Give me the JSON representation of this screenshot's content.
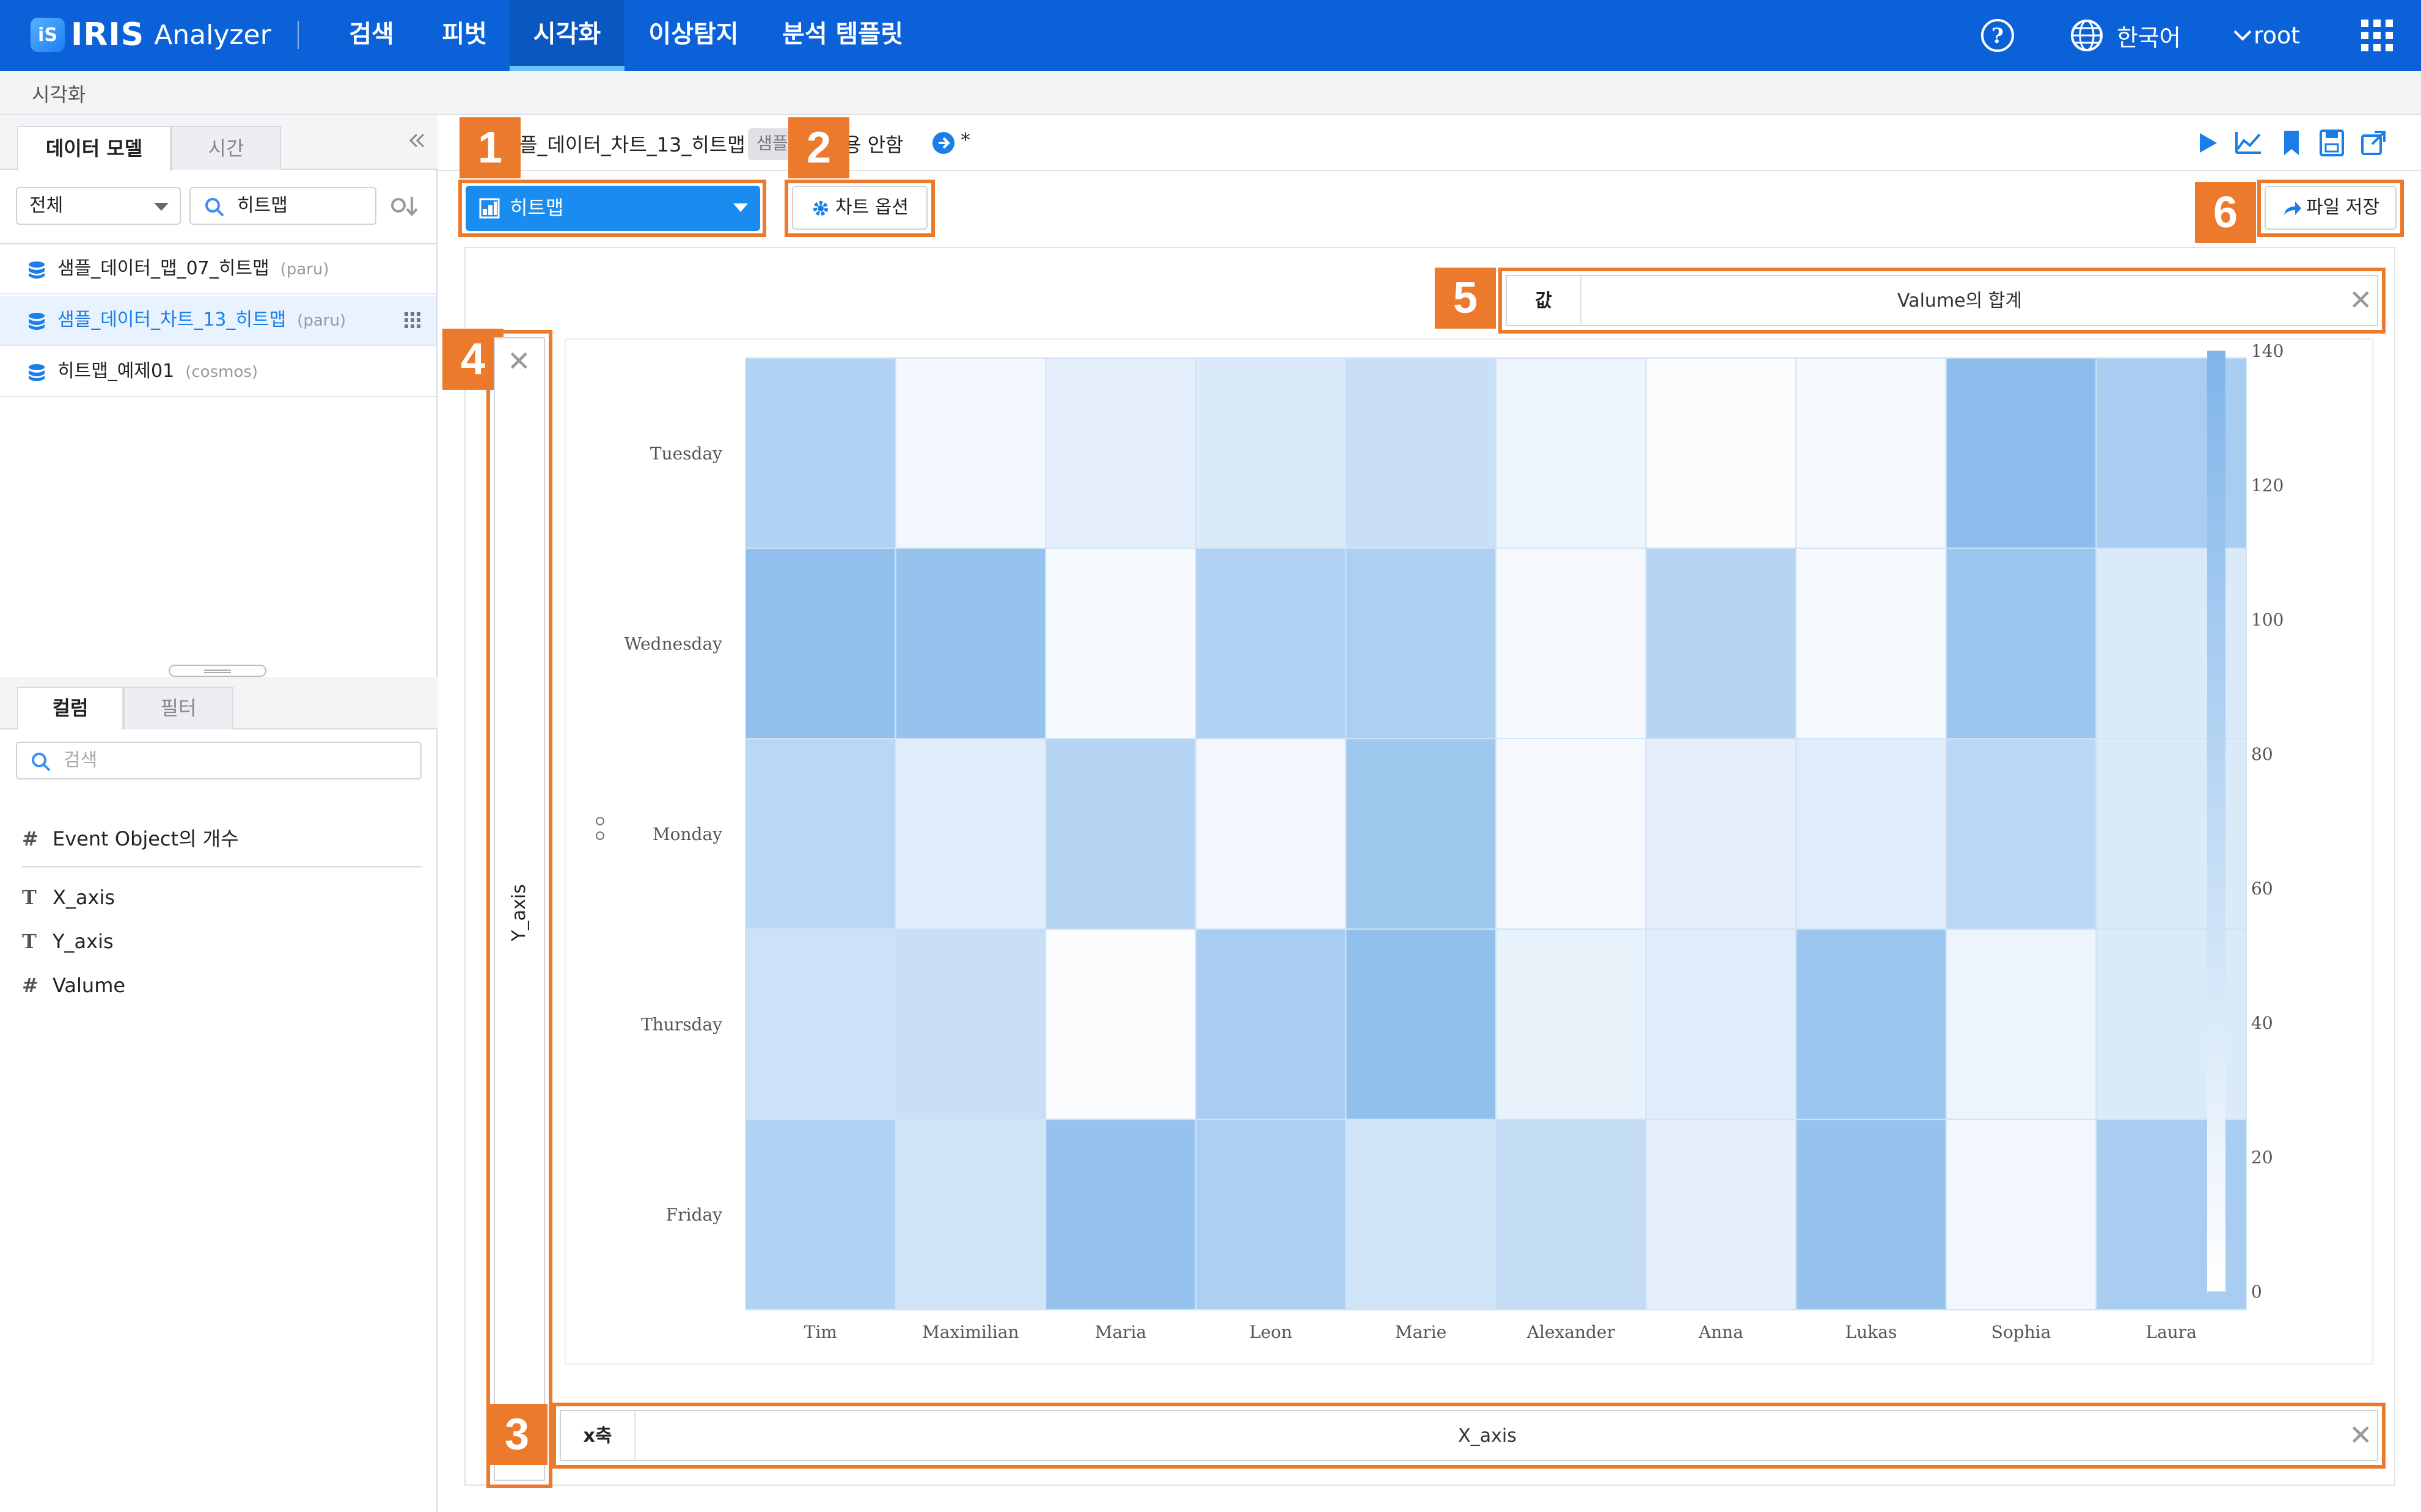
{
  "app": {
    "logo_brand": "IRIS",
    "logo_product": "Analyzer",
    "nav": [
      "검색",
      "피벗",
      "시각화",
      "이상탐지",
      "분석 템플릿"
    ],
    "active_nav": "시각화",
    "language": "한국어",
    "user": "root"
  },
  "breadcrumb": "시각화",
  "left_panel": {
    "tabs": [
      "데이터 모델",
      "시간"
    ],
    "scope_select": "전체",
    "search_value": "히트맵",
    "models": [
      {
        "name": "샘플_데이터_맵_07_히트맵",
        "owner": "(paru)"
      },
      {
        "name": "샘플_데이터_차트_13_히트맵",
        "owner": "(paru)"
      },
      {
        "name": "히트맵_예제01",
        "owner": "(cosmos)"
      }
    ],
    "bottom_tabs": [
      "컬럼",
      "필터"
    ],
    "column_search_placeholder": "검색",
    "columns": [
      {
        "type": "#",
        "name": "Event Object의 개수"
      },
      {
        "type": "T",
        "name": "X_axis"
      },
      {
        "type": "T",
        "name": "Y_axis"
      },
      {
        "type": "#",
        "name": "Valume"
      }
    ]
  },
  "main": {
    "title": "플_데이터_차트_13_히트맵",
    "sample_tag": "샘플",
    "status_text": "용 안함",
    "modified_mark": "*",
    "chart_type": "히트맵",
    "chart_options_label": "차트 옵션",
    "save_file_label": "파일 저장",
    "value_field_label": "값",
    "value_field": "Valume의 합계",
    "y_axis_field": "Y_axis",
    "x_axis_label": "x축",
    "x_axis_field": "X_axis",
    "callouts": [
      "1",
      "2",
      "3",
      "4",
      "5",
      "6"
    ]
  },
  "colors": {
    "accent": "#0b62d8",
    "callout": "#ec7a2c",
    "heat_max": "#7fb5ea",
    "heat_min": "#ffffff"
  },
  "chart_data": {
    "type": "heatmap",
    "x": [
      "Tim",
      "Maximilian",
      "Maria",
      "Leon",
      "Marie",
      "Alexander",
      "Anna",
      "Lukas",
      "Sophia",
      "Laura"
    ],
    "y": [
      "Tuesday",
      "Wednesday",
      "Monday",
      "Thursday",
      "Friday"
    ],
    "values": [
      [
        85,
        15,
        30,
        40,
        60,
        20,
        5,
        10,
        125,
        95
      ],
      [
        120,
        115,
        10,
        85,
        90,
        10,
        80,
        10,
        110,
        40
      ],
      [
        75,
        35,
        80,
        15,
        105,
        10,
        30,
        35,
        75,
        40
      ],
      [
        55,
        60,
        5,
        95,
        120,
        25,
        35,
        110,
        20,
        40
      ],
      [
        85,
        50,
        115,
        90,
        50,
        65,
        30,
        115,
        15,
        95
      ]
    ],
    "colorbar_ticks": [
      "140",
      "120",
      "100",
      "80",
      "60",
      "40",
      "20",
      "0"
    ],
    "value_range": [
      0,
      140
    ]
  }
}
